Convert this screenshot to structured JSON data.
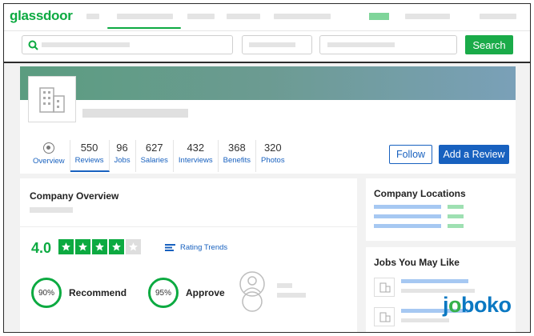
{
  "brand": {
    "logo_text": "glassdoor",
    "accent": "#0caa41",
    "link_color": "#1861bf"
  },
  "search": {
    "button_label": "Search"
  },
  "company": {
    "tabs": [
      {
        "number": "",
        "label": "Overview"
      },
      {
        "number": "550",
        "label": "Reviews"
      },
      {
        "number": "96",
        "label": "Jobs"
      },
      {
        "number": "627",
        "label": "Salaries"
      },
      {
        "number": "432",
        "label": "Interviews"
      },
      {
        "number": "368",
        "label": "Benefits"
      },
      {
        "number": "320",
        "label": "Photos"
      }
    ],
    "active_tab": "Reviews",
    "follow_label": "Follow",
    "review_label": "Add a Review"
  },
  "overview": {
    "title": "Company Overview",
    "rating": "4.0",
    "stars_filled": 4,
    "stars_total": 5,
    "trend_label": "Rating Trends",
    "recommend_pct": "90%",
    "recommend_label": "Recommend",
    "approve_pct": "95%",
    "approve_label": "Approve"
  },
  "locations": {
    "title": "Company Locations"
  },
  "jobs": {
    "title": "Jobs You May Like"
  },
  "watermark": {
    "text": "joboko"
  },
  "icons": [
    "search-icon",
    "building-icon",
    "overview-icon",
    "star-icon",
    "rating-trends-icon",
    "ceo-avatar-icon"
  ]
}
